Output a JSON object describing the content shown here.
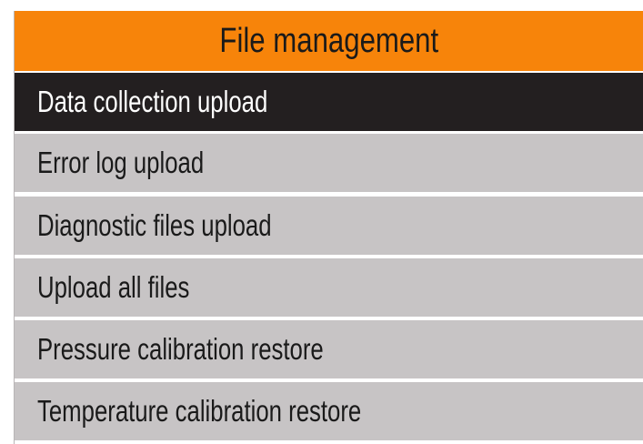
{
  "header": {
    "title": "File management"
  },
  "menu": {
    "items": [
      {
        "label": "Data collection upload",
        "selected": true
      },
      {
        "label": "Error log upload",
        "selected": false
      },
      {
        "label": "Diagnostic files upload",
        "selected": false
      },
      {
        "label": "Upload all files",
        "selected": false
      },
      {
        "label": "Pressure calibration restore",
        "selected": false
      },
      {
        "label": "Temperature calibration restore",
        "selected": false
      }
    ]
  },
  "colors": {
    "header_bg": "#f7840a",
    "item_bg": "#c7c4c5",
    "selected_bg": "#231f20",
    "selected_text": "#ffffff",
    "text": "#1a1a1a"
  }
}
